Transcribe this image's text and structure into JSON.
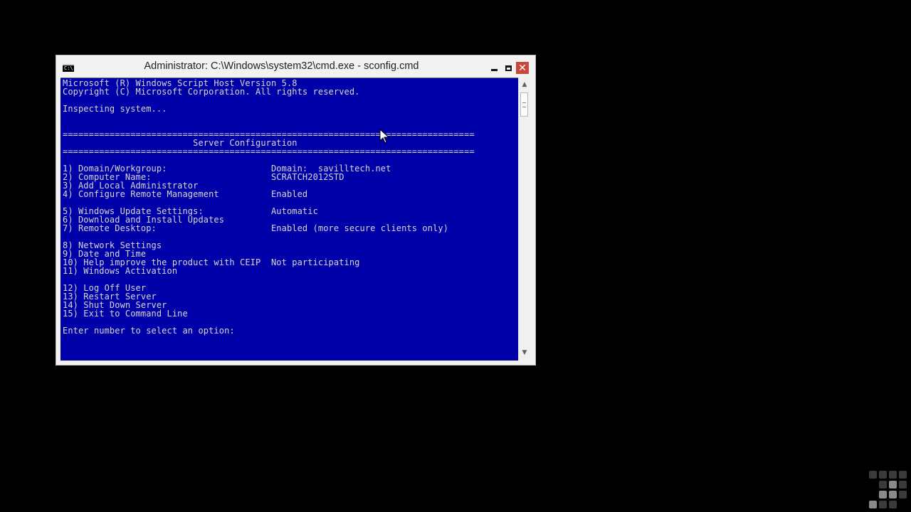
{
  "window": {
    "title": "Administrator: C:\\Windows\\system32\\cmd.exe - sconfig.cmd",
    "icon": "cmd-icon",
    "icon_text": "C:\\",
    "controls": {
      "minimize": "minimize-icon",
      "maximize": "maximize-icon",
      "close": "close-icon"
    }
  },
  "console": {
    "background": "#0000a8",
    "foreground": "#d7d7d7",
    "lines": [
      "Microsoft (R) Windows Script Host Version 5.8",
      "Copyright (C) Microsoft Corporation. All rights reserved.",
      "",
      "Inspecting system...",
      "",
      "",
      "===============================================================================",
      "                         Server Configuration",
      "===============================================================================",
      "",
      "1) Domain/Workgroup:                    Domain:  savilltech.net",
      "2) Computer Name:                       SCRATCH2012STD",
      "3) Add Local Administrator",
      "4) Configure Remote Management          Enabled",
      "",
      "5) Windows Update Settings:             Automatic",
      "6) Download and Install Updates",
      "7) Remote Desktop:                      Enabled (more secure clients only)",
      "",
      "8) Network Settings",
      "9) Date and Time",
      "10) Help improve the product with CEIP  Not participating",
      "11) Windows Activation",
      "",
      "12) Log Off User",
      "13) Restart Server",
      "14) Shut Down Server",
      "15) Exit to Command Line",
      "",
      "Enter number to select an option:"
    ]
  },
  "scrollbar": {
    "up": "chevron-up-icon",
    "down": "chevron-down-icon"
  }
}
